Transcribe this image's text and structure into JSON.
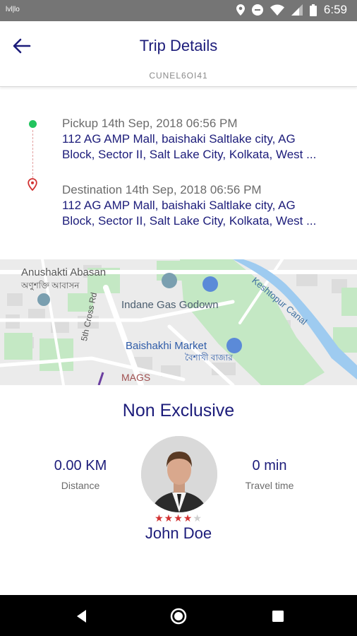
{
  "status_bar": {
    "carrier": "lvl|lo",
    "time": "6:59",
    "icons": [
      "location-icon",
      "do-not-disturb-icon",
      "wifi-icon",
      "signal-icon",
      "battery-icon"
    ]
  },
  "header": {
    "title": "Trip Details",
    "trip_code": "CUNEL6OI41",
    "back_icon": "arrow-left-icon"
  },
  "route": {
    "pickup": {
      "label": "Pickup 14th Sep, 2018 06:56 PM",
      "address_line1": "112 AG AMP Mall, baishaki Saltlake city, AG",
      "address_line2": "Block, Sector II, Salt Lake City, Kolkata, West ..."
    },
    "destination": {
      "label": "Destination 14th Sep, 2018 06:56 PM",
      "address_line1": "112 AG AMP Mall, baishaki Saltlake city, AG",
      "address_line2": "Block, Sector II, Salt Lake City, Kolkata, West ..."
    }
  },
  "map": {
    "labels": {
      "anushakti": "Anushakti Abasan",
      "anushakti_bn": "অণুশক্তি আবাসন",
      "indane": "Indane Gas Godown",
      "baishakhi": "Baishakhi Market",
      "baishakhi_bn": "বৈশাখী বাজার",
      "street": "5th Cross Rd",
      "canal": "Keshtopur Canal",
      "mags": "MAGS"
    }
  },
  "trip": {
    "type": "Non Exclusive",
    "distance_value": "0.00 KM",
    "distance_label": "Distance",
    "time_value": "0 min",
    "time_label": "Travel time",
    "rating": 4,
    "rating_max": 5,
    "driver_name": "John Doe"
  },
  "colors": {
    "accent": "#1c1c7a",
    "pickup_dot": "#22c45e",
    "destination_pin": "#d23232",
    "star_on": "#d23232"
  }
}
